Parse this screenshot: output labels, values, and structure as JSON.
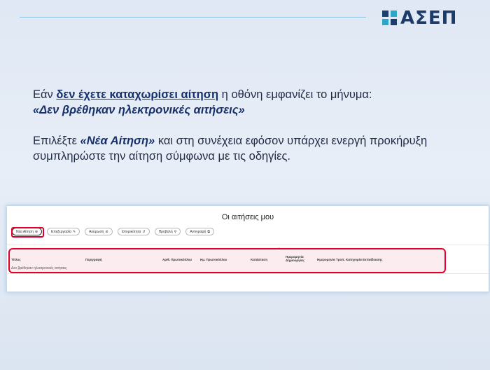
{
  "header": {
    "logo_text": "ΑΣΕΠ",
    "accent_color": "#8bbfe0",
    "brand_color": "#1c3b6b"
  },
  "instructions": {
    "line1_prefix": "Εάν ",
    "line1_emph": "δεν έχετε καταχωρίσει αίτηση",
    "line1_suffix": " η οθόνη εμφανίζει το μήνυμα:",
    "line2": "«Δεν βρέθηκαν ηλεκτρονικές αιτήσεις»",
    "line3_prefix": "Επιλέξτε ",
    "line3_emph": "«Νέα Αίτηση»",
    "line3_suffix": "  και στη συνέχεια εφόσον υπάρχει ενεργή προκήρυξη",
    "line4": "συμπληρώστε την αίτηση σύμφωνα με τις οδηγίες."
  },
  "screenshot": {
    "title": "Οι αιτήσεις μου",
    "buttons": [
      {
        "label": "Νέα Αίτηση",
        "icon": "plus-icon"
      },
      {
        "label": "Επεξεργασία",
        "icon": "pencil-icon"
      },
      {
        "label": "Ακύρωση",
        "icon": "cancel-icon"
      },
      {
        "label": "Ιστορικότητα",
        "icon": "history-icon"
      },
      {
        "label": "Προβολή",
        "icon": "search-icon"
      },
      {
        "label": "Αντιγραφή",
        "icon": "copy-icon"
      }
    ],
    "columns": [
      "Τίτλος",
      "Περιγραφή",
      "Αριθ. Πρωτοκόλλου",
      "Ημ. Πρωτοκόλλου",
      "Κατάσταση",
      "Ημερομηνία Δημιουργίας",
      "Ημερομηνία Τροπ. Κατηγορία Εκπαίδευσης"
    ],
    "empty_message": "Δεν βρέθηκαν ηλεκτρονικές αιτήσεις",
    "highlight_color": "#e0002a"
  }
}
